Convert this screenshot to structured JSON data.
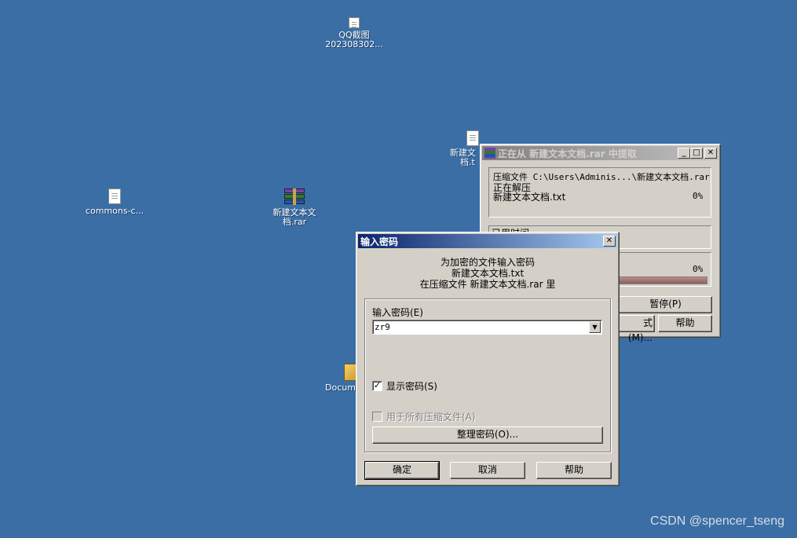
{
  "desktop": {
    "icons": [
      {
        "label_line1": "QQ截图",
        "label_line2": "202308302..."
      },
      {
        "label_line1": "commons-c..."
      },
      {
        "label_line1": "新建文本文",
        "label_line2": "档.rar"
      },
      {
        "label_line1": "新建文",
        "label_line2": "档.t"
      },
      {
        "label_line1": "Documen"
      }
    ]
  },
  "extract_window": {
    "title": "正在从 新建文本文档.rar 中提取",
    "archive_line": "压缩文件 C:\\Users\\Adminis...\\新建文本文档.rar",
    "status_line": "正在解压",
    "file_name": "新建文本文档.txt",
    "file_percent": "0%",
    "elapsed_label": "已用时间",
    "total_percent": "0%",
    "pause_button": "暂停(P)",
    "mode_button": "式(M)...",
    "help_button": "帮助"
  },
  "password_dialog": {
    "title": "输入密码",
    "message_line1": "为加密的文件输入密码",
    "message_line2": "新建文本文档.txt",
    "message_line3": "在压缩文件 新建文本文档.rar 里",
    "password_label": "输入密码(E)",
    "password_value": "zr9",
    "show_password_label": "显示密码(S)",
    "show_password_checked": true,
    "use_for_all_label": "用于所有压缩文件(A)",
    "use_for_all_checked": false,
    "organize_button": "整理密码(O)...",
    "ok_button": "确定",
    "cancel_button": "取消",
    "help_button": "帮助"
  },
  "watermark": "CSDN @spencer_tseng"
}
